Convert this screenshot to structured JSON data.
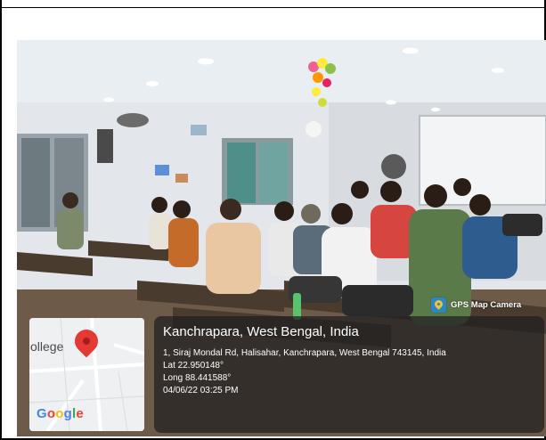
{
  "overlay": {
    "badge_label": "GPS Map Camera",
    "location_title": "Kanchrapara, West Bengal, India",
    "address": "1, Siraj Mondal Rd, Halisahar, Kanchrapara, West Bengal 743145, India",
    "latitude": "Lat 22.950148°",
    "longitude": "Long 88.441588°",
    "datetime": "04/06/22 03:25 PM"
  },
  "map": {
    "place_label": "ollege",
    "brand": [
      "G",
      "o",
      "o",
      "g",
      "l",
      "e"
    ],
    "brand_colors": [
      "#4285F4",
      "#EA4335",
      "#FBBC05",
      "#4285F4",
      "#34A853",
      "#EA4335"
    ]
  },
  "colors": {
    "pin": "#e53935",
    "panel_bg": "rgba(30,30,30,0.72)",
    "badge_icon": "#2a88c8"
  }
}
